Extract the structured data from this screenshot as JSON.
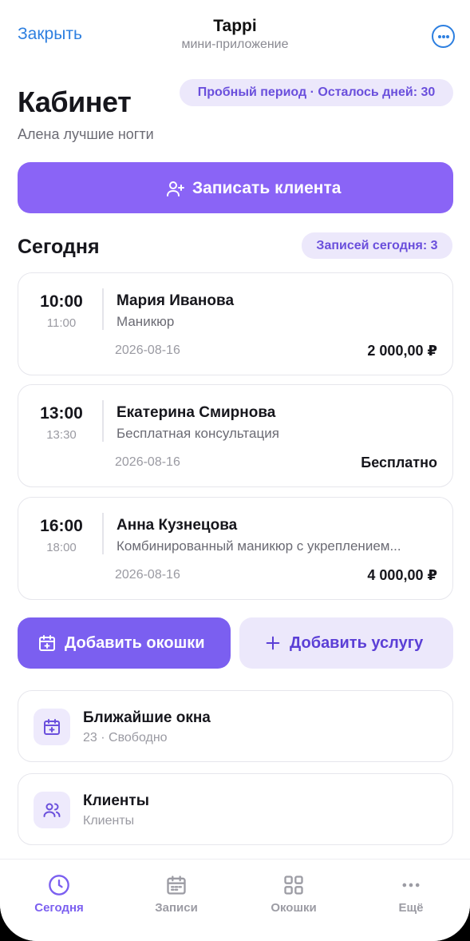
{
  "header": {
    "close_label": "Закрыть",
    "title": "Tappi",
    "subtitle": "мини-приложение",
    "more_icon": "ellipsis-circle-icon"
  },
  "page": {
    "title": "Кабинет",
    "trial_badge": "Пробный период · Осталось дней: 30",
    "business_name": "Алена лучшие ногти",
    "primary_action": "Записать клиента"
  },
  "today": {
    "title": "Сегодня",
    "count_badge": "Записей сегодня: 3",
    "appointments": [
      {
        "start": "10:00",
        "end": "11:00",
        "client": "Мария Иванова",
        "service": "Маникюр",
        "date": "2026-08-16",
        "price": "2 000,00 ₽"
      },
      {
        "start": "13:00",
        "end": "13:30",
        "client": "Екатерина Смирнова",
        "service": "Бесплатная консультация",
        "date": "2026-08-16",
        "price": "Бесплатно"
      },
      {
        "start": "16:00",
        "end": "18:00",
        "client": "Анна Кузнецова",
        "service": "Комбинированный маникюр с укреплением...",
        "date": "2026-08-16",
        "price": "4 000,00 ₽"
      }
    ]
  },
  "actions": {
    "add_slots": "Добавить окошки",
    "add_service": "Добавить услугу"
  },
  "cards": [
    {
      "title": "Ближайшие окна",
      "subtitle": "23 · Свободно",
      "icon": "calendar-plus-icon"
    },
    {
      "title": "Клиенты",
      "subtitle": "Клиенты",
      "icon": "users-icon"
    }
  ],
  "tabbar": [
    {
      "label": "Сегодня",
      "icon": "clock-icon",
      "active": true
    },
    {
      "label": "Записи",
      "icon": "calendar-icon",
      "active": false
    },
    {
      "label": "Окошки",
      "icon": "grid-icon",
      "active": false
    },
    {
      "label": "Ещё",
      "icon": "more-horizontal-icon",
      "active": false
    }
  ],
  "colors": {
    "accent": "#8a64f6",
    "accent_dark": "#7b5ff0",
    "accent_soft": "#ece8fb",
    "link": "#2d7fe0"
  }
}
